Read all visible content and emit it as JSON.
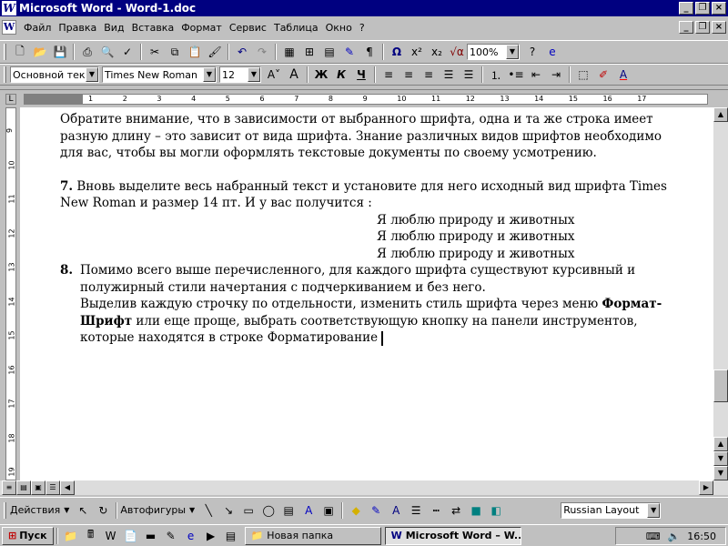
{
  "window": {
    "title": "Microsoft Word - Word-1.doc",
    "app_icon": "W"
  },
  "menu": [
    "Файл",
    "Правка",
    "Вид",
    "Вставка",
    "Формат",
    "Сервис",
    "Таблица",
    "Окно",
    "?"
  ],
  "toolbar_standard": {
    "zoom": "100%"
  },
  "toolbar_format": {
    "style": "Основной текст",
    "font": "Times New Roman",
    "size": "12",
    "bold_label": "Ж",
    "italic_label": "К",
    "underline_label": "Ч"
  },
  "ruler": {
    "marks": [
      "1",
      "2",
      "3",
      "4",
      "5",
      "6",
      "7",
      "8",
      "9",
      "10",
      "11",
      "12",
      "13",
      "14",
      "15",
      "16",
      "17"
    ],
    "vmarks": [
      "9",
      "10",
      "11",
      "12",
      "13",
      "14",
      "15",
      "16",
      "17",
      "18",
      "19"
    ]
  },
  "document": {
    "para1": "Обратите внимание, что в зависимости от выбранного шрифта, одна и та же строка  имеет разную длину – это зависит от вида шрифта. Знание различных видов шрифтов необходимо для вас, чтобы вы могли оформлять текстовые документы по своему усмотрению.",
    "item7_num": "7.",
    "item7_text": "Вновь выделите весь набранный текст и установите для него исходный вид шрифта Times New Roman и размер 14 пт. И у вас получится :",
    "sample_line": "Я люблю природу и животных",
    "item8_num": "8.",
    "item8_line1": "Помимо всего выше перечисленного, для каждого шрифта существуют курсивный и полужирный стили начертания с подчеркиванием и без него.",
    "item8_line2_start": "Выделив каждую строчку по отдельности, изменить стиль шрифта через меню ",
    "item8_bold": "Формат-Шрифт",
    "item8_line2_end": " или еще проще, выбрать соответствующую кнопку на панели инструментов, которые находятся в  строке Форматирование"
  },
  "drawing_toolbar": {
    "actions": "Действия",
    "autoshapes": "Автофигуры",
    "language": "Russian Layout"
  },
  "taskbar": {
    "start": "Пуск",
    "task1": "Новая папка",
    "task2": "Microsoft Word – W...",
    "clock": "16:50"
  }
}
